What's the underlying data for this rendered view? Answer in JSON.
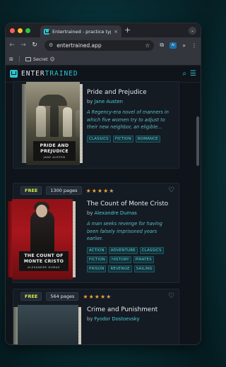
{
  "browser": {
    "tab_title": "Entertrained - practice typing",
    "tab_close": "×",
    "new_tab": "+",
    "tab_menu": "⌄",
    "url": "entertrained.app",
    "bookmark_folder": "Secret",
    "bookmark_emoji": "😉",
    "ext_badge": "Ai"
  },
  "site": {
    "logo_prefix": "ENTER",
    "logo_suffix": "TRAINED"
  },
  "books": [
    {
      "title": "Pride and Prejudice",
      "by": "by",
      "author": "Jane Austen",
      "description": "A Regency-era novel of manners in which five women try to adjust to their new neighbor, an eligible...",
      "tags": [
        "CLASSICS",
        "FICTION",
        "ROMANCE"
      ],
      "cover_title": "PRIDE AND PREJUDICE",
      "cover_author": "JANE AUSTEN"
    },
    {
      "badge": "FREE",
      "pages": "1300 pages",
      "rating": 4.5,
      "title": "The Count of Monte Cristo",
      "by": "by",
      "author": "Alexandre Dumas",
      "description": "A man seeks revenge for having been falsely imprisoned years earlier.",
      "tags": [
        "ACTION",
        "ADVENTURE",
        "CLASSICS",
        "FICTION",
        "HISTORY",
        "PIRATES",
        "PRISON",
        "REVENGE",
        "SAILING"
      ],
      "cover_title": "THE COUNT OF MONTE CRISTO",
      "cover_author": "ALEXANDRE DUMAS"
    },
    {
      "badge": "FREE",
      "pages": "564 pages",
      "rating": 4.5,
      "title": "Crime and Punishment",
      "by": "by",
      "author": "Fyodor Dostoevsky"
    }
  ]
}
